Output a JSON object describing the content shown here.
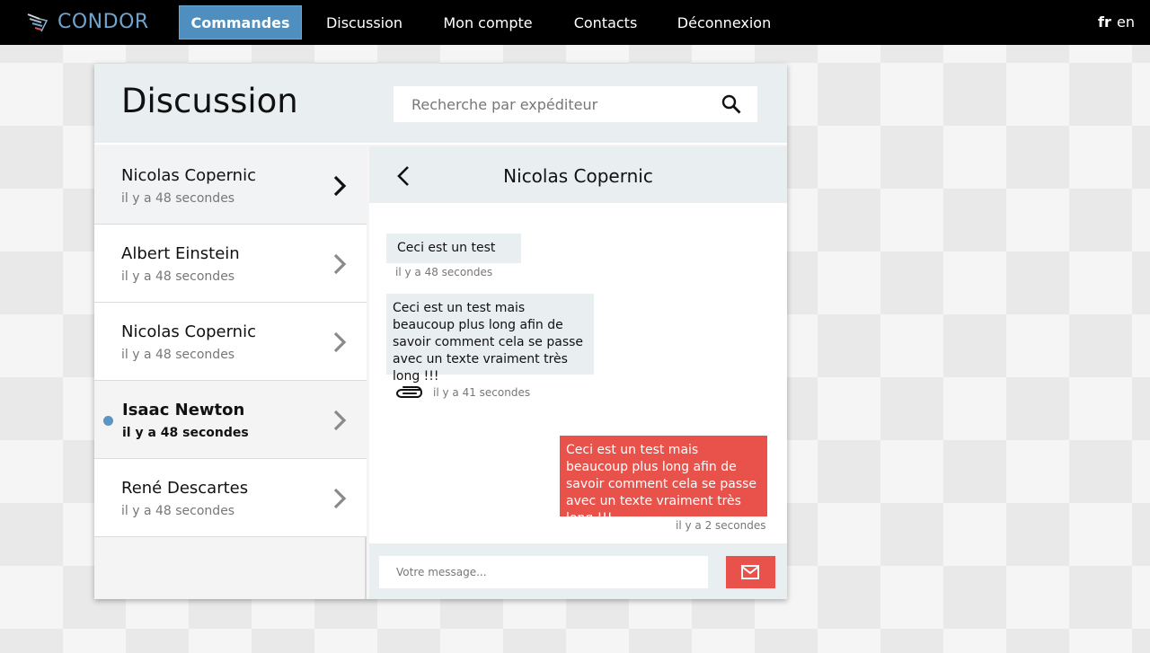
{
  "app": {
    "logo_text": "CONDOR"
  },
  "nav": {
    "items": [
      {
        "label": "Commandes"
      },
      {
        "label": "Discussion"
      },
      {
        "label": "Mon compte"
      },
      {
        "label": "Contacts"
      },
      {
        "label": "Déconnexion"
      }
    ],
    "languages": [
      {
        "label": "fr"
      },
      {
        "label": "en"
      }
    ]
  },
  "panel": {
    "title": "Discussion",
    "search_placeholder": "Recherche par expéditeur"
  },
  "conversations": [
    {
      "name": "Nicolas Copernic",
      "time": "il y a 48 secondes"
    },
    {
      "name": "Albert Einstein",
      "time": "il y a 48 secondes"
    },
    {
      "name": "Nicolas Copernic",
      "time": "il y a 48 secondes"
    },
    {
      "name": "Isaac Newton",
      "time": "il y a 48 secondes"
    },
    {
      "name": "René Descartes",
      "time": "il y a 48 secondes"
    }
  ],
  "chat": {
    "title": "Nicolas Copernic",
    "messages": [
      {
        "text": "Ceci est un test",
        "time": "il y a 48 secondes"
      },
      {
        "text": "Ceci est un test mais beaucoup plus long afin de savoir comment cela se passe avec un texte vraiment très long !!!",
        "time": "il y a 41 secondes"
      },
      {
        "text": "Ceci est un test mais beaucoup plus long afin de savoir comment cela se passe avec un texte vraiment très long !!!",
        "time": "il y a 2 secondes"
      }
    ],
    "composer_placeholder": "Votre message..."
  },
  "colors": {
    "accent": "#4f8fc0",
    "outgoing_bubble": "#e8524a",
    "unread_dot": "#5c94c3"
  }
}
